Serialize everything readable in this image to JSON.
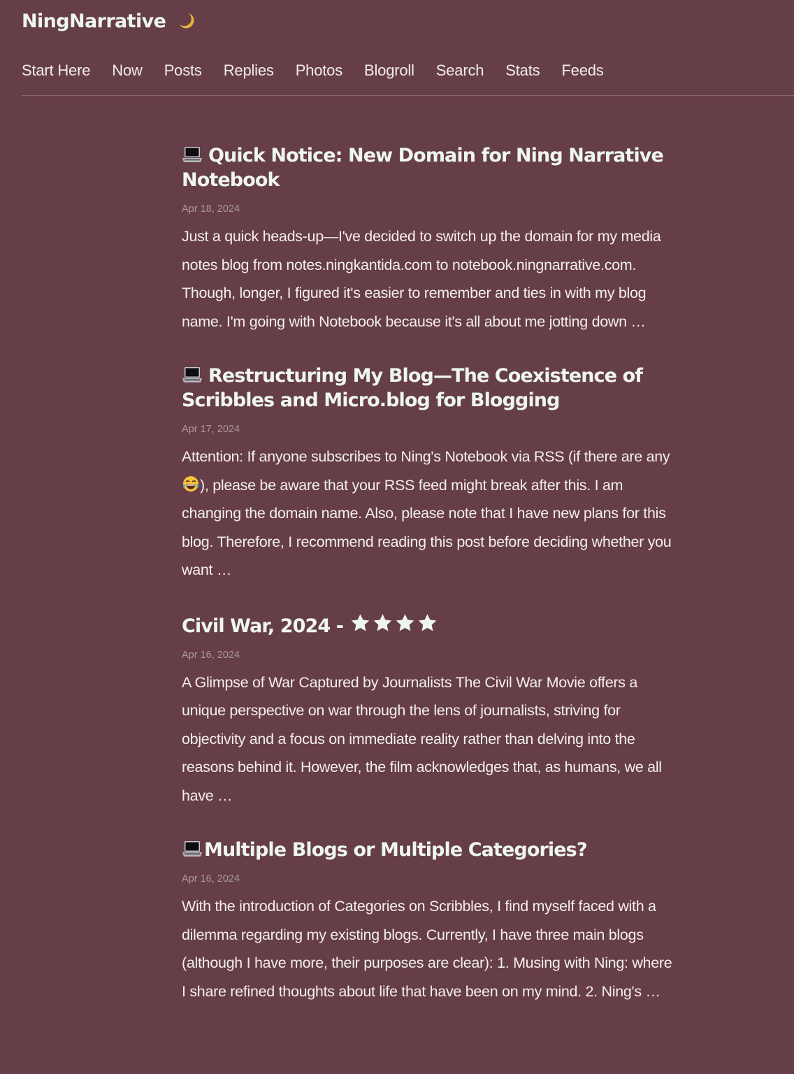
{
  "site": {
    "title": "NingNarrative",
    "title_icon": "crescent-moon-icon"
  },
  "nav": {
    "items": [
      {
        "label": "Start Here"
      },
      {
        "label": "Now"
      },
      {
        "label": "Posts"
      },
      {
        "label": "Replies"
      },
      {
        "label": "Photos"
      },
      {
        "label": "Blogroll"
      },
      {
        "label": "Search"
      },
      {
        "label": "Stats"
      },
      {
        "label": "Feeds"
      }
    ]
  },
  "colors": {
    "background": "#663e47",
    "title_text": "#eef7ef",
    "body_text": "#f2efec",
    "date_text": "#a8999c",
    "divider": "#8a6b72"
  },
  "posts": [
    {
      "icon": "laptop-icon",
      "title": "Quick Notice: New Domain for Ning Narrative Notebook",
      "date": "Apr 18, 2024",
      "excerpt": "Just a quick heads-up—I've decided to switch up the domain for my media notes blog from notes.ningkantida.com to notebook.ningnarrative.com. Though, longer, I figured it's easier to remember and ties in with my blog name. I'm going with Notebook because it's all about me jotting down …"
    },
    {
      "icon": "laptop-icon",
      "title": "Restructuring My Blog—The Coexistence of Scribbles and Micro.blog for Blogging",
      "date": "Apr 17, 2024",
      "excerpt_before_emoji": "Attention: If anyone subscribes to Ning's Notebook via RSS (if there are any ",
      "excerpt_emoji": "face-with-tears-of-joy-icon",
      "excerpt_after_emoji": "), please be aware that your RSS feed might break after this. I am changing the domain name. Also, please note that I have new plans for this blog. Therefore, I recommend reading this post before deciding whether you want …"
    },
    {
      "title": "Civil War, 2024 - ",
      "rating_stars": 4,
      "date": "Apr 16, 2024",
      "excerpt": "A Glimpse of War Captured by Journalists The Civil War Movie offers a unique perspective on war through the lens of journalists, striving for objectivity and a focus on immediate reality rather than delving into the reasons behind it. However, the film acknowledges that, as humans, we all have …"
    },
    {
      "icon": "laptop-icon",
      "title": "Multiple Blogs or Multiple Categories?",
      "date": "Apr 16, 2024",
      "excerpt": "With the introduction of Categories on Scribbles, I find myself faced with a dilemma regarding my existing blogs. Currently, I have three main blogs (although I have more, their purposes are clear): 1. Musing with Ning: where I share refined thoughts about life that have been on my mind. 2. Ning's …"
    }
  ]
}
